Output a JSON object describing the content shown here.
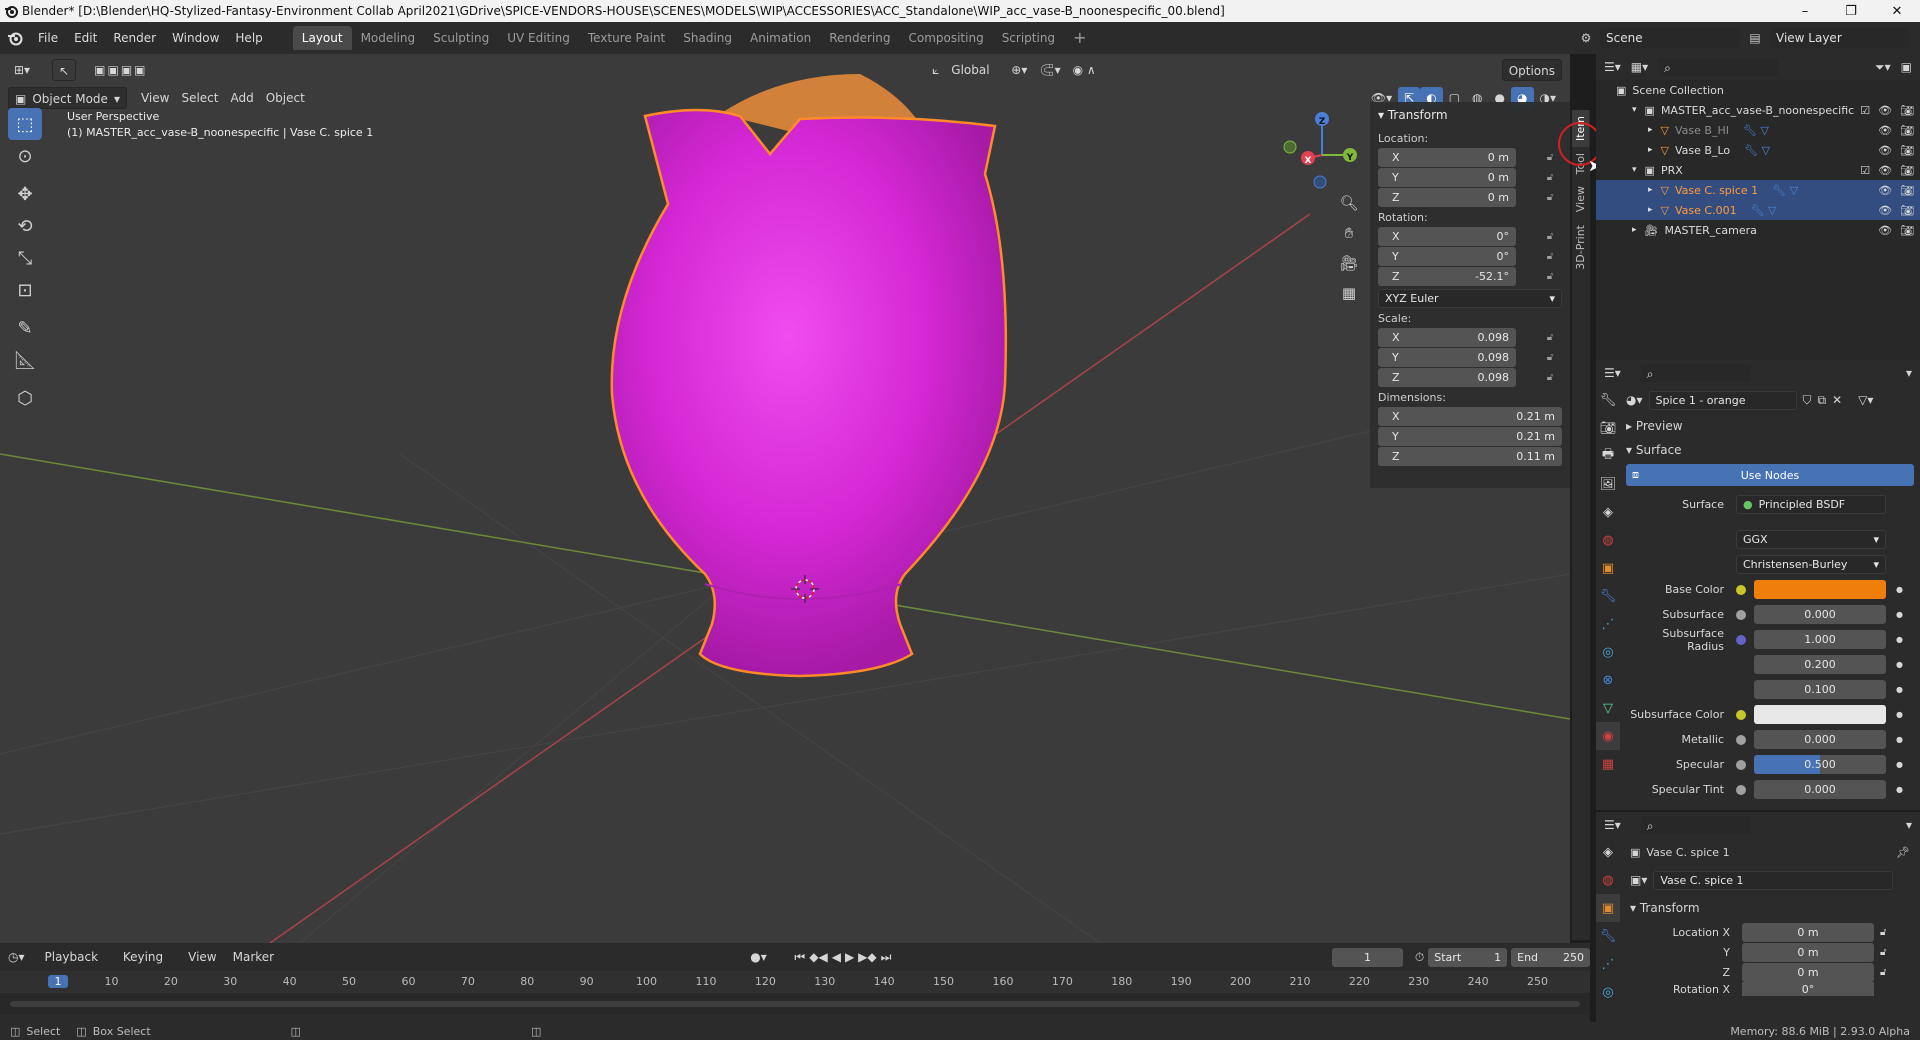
{
  "window": {
    "title": "Blender* [D:\\Blender\\HQ-Stylized-Fantasy-Environment  Collab April2021\\GDrive\\SPICE-VENDORS-HOUSE\\SCENES\\MODELS\\WIP\\ACCESSORIES\\ACC_Standalone\\WIP_acc_vase-B_noonespecific_00.blend]",
    "minimize": "–",
    "maximize": "❐",
    "close": "✕"
  },
  "menu": [
    "File",
    "Edit",
    "Render",
    "Window",
    "Help"
  ],
  "workspaces": [
    {
      "label": "Layout",
      "active": true
    },
    {
      "label": "Modeling"
    },
    {
      "label": "Sculpting"
    },
    {
      "label": "UV Editing"
    },
    {
      "label": "Texture Paint"
    },
    {
      "label": "Shading"
    },
    {
      "label": "Animation"
    },
    {
      "label": "Rendering"
    },
    {
      "label": "Compositing"
    },
    {
      "label": "Scripting"
    }
  ],
  "scene": {
    "name": "Scene",
    "view_layer": "View Layer"
  },
  "viewport": {
    "mode": "Object Mode",
    "header_menus": [
      "View",
      "Select",
      "Add",
      "Object"
    ],
    "orientation": "Global",
    "options": "Options",
    "overlay_title": "User Perspective",
    "overlay_subtitle": "(1) MASTER_acc_vase-B_noonespecific | Vase C. spice 1",
    "gizmo": {
      "x": "X",
      "y": "Y",
      "z": "Z"
    }
  },
  "npanel": {
    "section": "Transform",
    "location_label": "Location:",
    "location": [
      {
        "axis": "X",
        "value": "0 m"
      },
      {
        "axis": "Y",
        "value": "0 m"
      },
      {
        "axis": "Z",
        "value": "0 m"
      }
    ],
    "rotation_label": "Rotation:",
    "rotation": [
      {
        "axis": "X",
        "value": "0°"
      },
      {
        "axis": "Y",
        "value": "0°"
      },
      {
        "axis": "Z",
        "value": "-52.1°"
      }
    ],
    "rotation_mode": "XYZ Euler",
    "scale_label": "Scale:",
    "scale": [
      {
        "axis": "X",
        "value": "0.098"
      },
      {
        "axis": "Y",
        "value": "0.098"
      },
      {
        "axis": "Z",
        "value": "0.098"
      }
    ],
    "dimensions_label": "Dimensions:",
    "dimensions": [
      {
        "axis": "X",
        "value": "0.21 m"
      },
      {
        "axis": "Y",
        "value": "0.21 m"
      },
      {
        "axis": "Z",
        "value": "0.11 m"
      }
    ],
    "tabs": [
      "Item",
      "Tool",
      "View",
      "3D-Print"
    ]
  },
  "outliner": {
    "root": "Scene Collection",
    "items": [
      {
        "name": "MASTER_acc_vase-B_noonespecific",
        "indent": 1,
        "type": "collection"
      },
      {
        "name": "Vase B_HI",
        "indent": 2,
        "type": "mesh",
        "dim": true
      },
      {
        "name": "Vase B_Lo",
        "indent": 2,
        "type": "mesh"
      },
      {
        "name": "PRX",
        "indent": 1,
        "type": "collection"
      },
      {
        "name": "Vase C. spice 1",
        "indent": 2,
        "type": "mesh",
        "selected": true
      },
      {
        "name": "Vase C.001",
        "indent": 2,
        "type": "mesh",
        "selected": true
      },
      {
        "name": "MASTER_camera",
        "indent": 1,
        "type": "camera"
      }
    ]
  },
  "material": {
    "name": "Spice 1 - orange",
    "preview": "Preview",
    "surface_section": "Surface",
    "use_nodes": "Use Nodes",
    "surface_label": "Surface",
    "surface_value": "Principled BSDF",
    "distribution": "GGX",
    "subsurface_method": "Christensen-Burley",
    "rows": [
      {
        "label": "Base Color",
        "value": "",
        "dot": "#c7c729",
        "color": "#f07e0a"
      },
      {
        "label": "Subsurface",
        "value": "0.000",
        "dot": "#a0a0a0"
      },
      {
        "label": "Subsurface Radius",
        "value": "1.000",
        "dot": "#6363c7"
      },
      {
        "label": "",
        "value": "0.200"
      },
      {
        "label": "",
        "value": "0.100"
      },
      {
        "label": "Subsurface Color",
        "value": "",
        "dot": "#c7c729",
        "color": "#e8e8e8"
      },
      {
        "label": "Metallic",
        "value": "0.000",
        "dot": "#a0a0a0"
      },
      {
        "label": "Specular",
        "value": "0.500",
        "dot": "#a0a0a0",
        "fill": 0.5
      },
      {
        "label": "Specular Tint",
        "value": "0.000",
        "dot": "#a0a0a0"
      }
    ]
  },
  "object_props": {
    "name": "Vase C. spice 1",
    "data_name": "Vase C. spice 1",
    "section": "Transform",
    "location_label": "Location X",
    "loc": [
      "0 m",
      "0 m",
      "0 m"
    ],
    "loc_axes": [
      "Location X",
      "Y",
      "Z"
    ],
    "rotation_label": "Rotation X",
    "rotation_value": "0°"
  },
  "timeline": {
    "menus": [
      "Playback",
      "Keying",
      "View",
      "Marker"
    ],
    "current_frame": "1",
    "start_label": "Start",
    "start": "1",
    "end_label": "End",
    "end": "250",
    "ticks": [
      "1",
      "10",
      "20",
      "30",
      "40",
      "50",
      "60",
      "70",
      "80",
      "90",
      "100",
      "110",
      "120",
      "130",
      "140",
      "150",
      "160",
      "170",
      "180",
      "190",
      "200",
      "210",
      "220",
      "230",
      "240",
      "250"
    ]
  },
  "status": {
    "select": "Select",
    "box_select": "Box Select",
    "memory": "Memory: 88.6 MiB | 2.93.0 Alpha"
  },
  "colors": {
    "accent": "#4772b3",
    "selected_object": "#ff9b3b",
    "vase_body": "#d327d3",
    "vase_outline": "#ff8a2a",
    "lid": "#d2813a"
  }
}
